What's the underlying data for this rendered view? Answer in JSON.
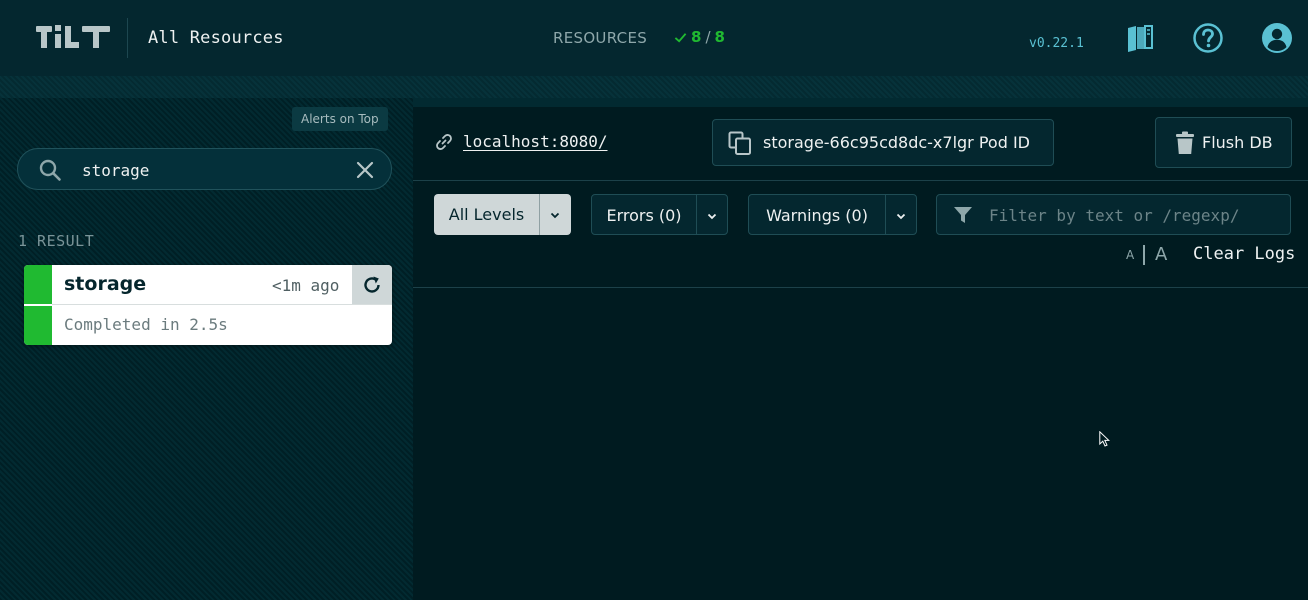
{
  "header": {
    "logo_text": "TiLT",
    "title": "All Resources",
    "resources_label": "RESOURCES",
    "resources_ok": "8",
    "resources_total": "8",
    "version": "v0.22.1",
    "icons": [
      "docs-icon",
      "help-icon",
      "account-icon"
    ]
  },
  "sidebar": {
    "alerts_on_top_label": "Alerts on Top",
    "search": {
      "value": "storage",
      "placeholder": ""
    },
    "result_count": "1 RESULT",
    "resources": [
      {
        "name": "storage",
        "updated": "<1m ago",
        "status_text": "Completed in 2.5s",
        "status_color": "#20ba31"
      }
    ]
  },
  "main": {
    "endpoint": "localhost:8080/",
    "pod_id_label": "storage-66c95cd8dc-x7lgr Pod ID",
    "flush_db_label": "Flush DB",
    "filters": {
      "all_levels": "All Levels",
      "errors": "Errors (0)",
      "warnings": "Warnings (0)",
      "selected": "All Levels",
      "text_filter_placeholder": "Filter by text or /regexp/"
    },
    "font_size_small": "A",
    "font_size_large": "A",
    "clear_logs": "Clear Logs"
  },
  "colors": {
    "background": "#001b20",
    "header": "#04272f",
    "success": "#20ba31",
    "accent": "#5ac1d3"
  }
}
